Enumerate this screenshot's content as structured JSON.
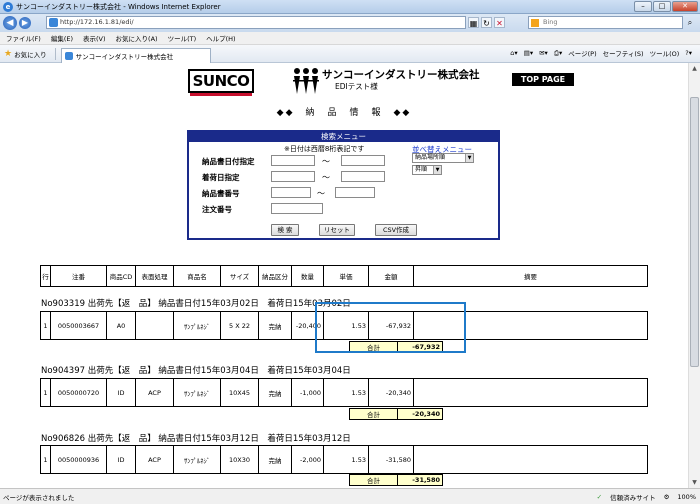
{
  "window": {
    "title": "サンコーインダストリー株式会社 - Windows Internet Explorer",
    "url": "http://172.16.1.81/edi/",
    "search_placeholder": "Bing"
  },
  "menu": [
    "ファイル(F)",
    "編集(E)",
    "表示(V)",
    "お気に入り(A)",
    "ツール(T)",
    "ヘルプ(H)"
  ],
  "favorites": {
    "label": "お気に入り",
    "tab_title": "サンコーインダストリー株式会社"
  },
  "commandbar": [
    "ページ(P)",
    "セーフティ(S)",
    "ツール(O)"
  ],
  "page": {
    "logo_text": "SUNCO",
    "company": "サンコーインダストリー株式会社",
    "edi_user": "EDIテスト様",
    "top_page": "TOP PAGE",
    "title": "◆◆　納　品　情　報　◆◆"
  },
  "search": {
    "header": "検索メニュー",
    "note": "※日付は西暦8桁表記です",
    "sort_link": "並べ替えメニュー",
    "sort_field": "納品場所順",
    "sort_order": "昇順",
    "labels": [
      "納品書日付指定",
      "着荷日指定",
      "納品書番号",
      "注文番号"
    ],
    "tilde": "～",
    "buttons": {
      "search": "検 索",
      "reset": "リセット",
      "csv": "CSV作成"
    }
  },
  "columns": [
    "行",
    "注番",
    "商品CD",
    "表面処理",
    "商品名",
    "サイズ",
    "納品区分",
    "数量",
    "単価",
    "金額",
    "摘要"
  ],
  "orders": [
    {
      "header": "No903319  出荷先【返　品】  納品書日付15年03月02日　着荷日15年03月02日",
      "row": [
        "1",
        "0050003667",
        "A0",
        "",
        "ｻﾝﾌﾟﾙﾈｼﾞ",
        "5 X 22",
        "完納",
        "-20,400",
        "1.53",
        "-67,932",
        ""
      ],
      "total_label": "合計",
      "total": "-67,932"
    },
    {
      "header": "No904397  出荷先【返　品】  納品書日付15年03月04日　着荷日15年03月04日",
      "row": [
        "1",
        "0050000720",
        "ID",
        "ACP",
        "ｻﾝﾌﾟﾙﾈｼﾞ",
        "10X45",
        "完納",
        "-1,000",
        "1.53",
        "-20,340",
        ""
      ],
      "total_label": "合計",
      "total": "-20,340"
    },
    {
      "header": "No906826  出荷先【返　品】  納品書日付15年03月12日　着荷日15年03月12日",
      "row": [
        "1",
        "0050000936",
        "ID",
        "ACP",
        "ｻﾝﾌﾟﾙﾈｼﾞ",
        "10X30",
        "完納",
        "-2,000",
        "1.53",
        "-31,580",
        ""
      ],
      "total_label": "合計",
      "total": "-31,580"
    }
  ],
  "status": {
    "left": "ページが表示されました",
    "zone": "信頼済みサイト",
    "zoom": "100%"
  }
}
